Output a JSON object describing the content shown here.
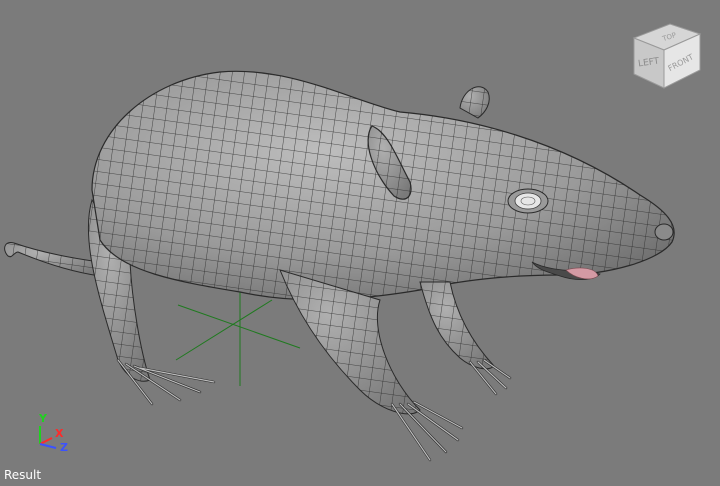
{
  "viewport": {
    "background_color": "#7b7b7b",
    "panel_label": "Result",
    "model": "rat-wireframe-mesh"
  },
  "viewcube": {
    "faces": [
      "TOP",
      "LEFT",
      "FRONT"
    ]
  },
  "axis_triad": {
    "y_label": "Y",
    "x_label": "X",
    "z_label": "Z",
    "y_color": "#1fd21f",
    "x_color": "#ff2a2a",
    "z_color": "#3b52ff"
  },
  "grid_color": "#1f7a1f"
}
